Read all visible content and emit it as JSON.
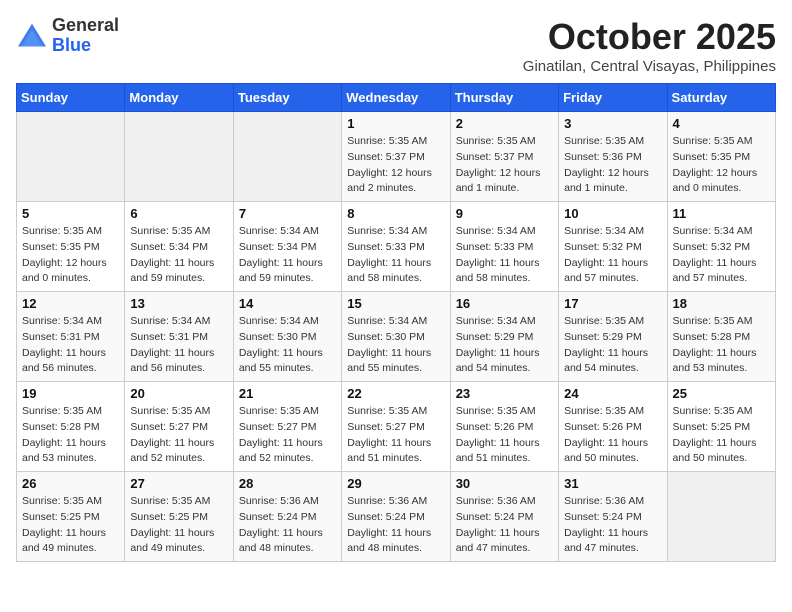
{
  "header": {
    "logo_general": "General",
    "logo_blue": "Blue",
    "month": "October 2025",
    "location": "Ginatilan, Central Visayas, Philippines"
  },
  "days_of_week": [
    "Sunday",
    "Monday",
    "Tuesday",
    "Wednesday",
    "Thursday",
    "Friday",
    "Saturday"
  ],
  "weeks": [
    [
      {
        "day": "",
        "info": ""
      },
      {
        "day": "",
        "info": ""
      },
      {
        "day": "",
        "info": ""
      },
      {
        "day": "1",
        "info": "Sunrise: 5:35 AM\nSunset: 5:37 PM\nDaylight: 12 hours\nand 2 minutes."
      },
      {
        "day": "2",
        "info": "Sunrise: 5:35 AM\nSunset: 5:37 PM\nDaylight: 12 hours\nand 1 minute."
      },
      {
        "day": "3",
        "info": "Sunrise: 5:35 AM\nSunset: 5:36 PM\nDaylight: 12 hours\nand 1 minute."
      },
      {
        "day": "4",
        "info": "Sunrise: 5:35 AM\nSunset: 5:35 PM\nDaylight: 12 hours\nand 0 minutes."
      }
    ],
    [
      {
        "day": "5",
        "info": "Sunrise: 5:35 AM\nSunset: 5:35 PM\nDaylight: 12 hours\nand 0 minutes."
      },
      {
        "day": "6",
        "info": "Sunrise: 5:35 AM\nSunset: 5:34 PM\nDaylight: 11 hours\nand 59 minutes."
      },
      {
        "day": "7",
        "info": "Sunrise: 5:34 AM\nSunset: 5:34 PM\nDaylight: 11 hours\nand 59 minutes."
      },
      {
        "day": "8",
        "info": "Sunrise: 5:34 AM\nSunset: 5:33 PM\nDaylight: 11 hours\nand 58 minutes."
      },
      {
        "day": "9",
        "info": "Sunrise: 5:34 AM\nSunset: 5:33 PM\nDaylight: 11 hours\nand 58 minutes."
      },
      {
        "day": "10",
        "info": "Sunrise: 5:34 AM\nSunset: 5:32 PM\nDaylight: 11 hours\nand 57 minutes."
      },
      {
        "day": "11",
        "info": "Sunrise: 5:34 AM\nSunset: 5:32 PM\nDaylight: 11 hours\nand 57 minutes."
      }
    ],
    [
      {
        "day": "12",
        "info": "Sunrise: 5:34 AM\nSunset: 5:31 PM\nDaylight: 11 hours\nand 56 minutes."
      },
      {
        "day": "13",
        "info": "Sunrise: 5:34 AM\nSunset: 5:31 PM\nDaylight: 11 hours\nand 56 minutes."
      },
      {
        "day": "14",
        "info": "Sunrise: 5:34 AM\nSunset: 5:30 PM\nDaylight: 11 hours\nand 55 minutes."
      },
      {
        "day": "15",
        "info": "Sunrise: 5:34 AM\nSunset: 5:30 PM\nDaylight: 11 hours\nand 55 minutes."
      },
      {
        "day": "16",
        "info": "Sunrise: 5:34 AM\nSunset: 5:29 PM\nDaylight: 11 hours\nand 54 minutes."
      },
      {
        "day": "17",
        "info": "Sunrise: 5:35 AM\nSunset: 5:29 PM\nDaylight: 11 hours\nand 54 minutes."
      },
      {
        "day": "18",
        "info": "Sunrise: 5:35 AM\nSunset: 5:28 PM\nDaylight: 11 hours\nand 53 minutes."
      }
    ],
    [
      {
        "day": "19",
        "info": "Sunrise: 5:35 AM\nSunset: 5:28 PM\nDaylight: 11 hours\nand 53 minutes."
      },
      {
        "day": "20",
        "info": "Sunrise: 5:35 AM\nSunset: 5:27 PM\nDaylight: 11 hours\nand 52 minutes."
      },
      {
        "day": "21",
        "info": "Sunrise: 5:35 AM\nSunset: 5:27 PM\nDaylight: 11 hours\nand 52 minutes."
      },
      {
        "day": "22",
        "info": "Sunrise: 5:35 AM\nSunset: 5:27 PM\nDaylight: 11 hours\nand 51 minutes."
      },
      {
        "day": "23",
        "info": "Sunrise: 5:35 AM\nSunset: 5:26 PM\nDaylight: 11 hours\nand 51 minutes."
      },
      {
        "day": "24",
        "info": "Sunrise: 5:35 AM\nSunset: 5:26 PM\nDaylight: 11 hours\nand 50 minutes."
      },
      {
        "day": "25",
        "info": "Sunrise: 5:35 AM\nSunset: 5:25 PM\nDaylight: 11 hours\nand 50 minutes."
      }
    ],
    [
      {
        "day": "26",
        "info": "Sunrise: 5:35 AM\nSunset: 5:25 PM\nDaylight: 11 hours\nand 49 minutes."
      },
      {
        "day": "27",
        "info": "Sunrise: 5:35 AM\nSunset: 5:25 PM\nDaylight: 11 hours\nand 49 minutes."
      },
      {
        "day": "28",
        "info": "Sunrise: 5:36 AM\nSunset: 5:24 PM\nDaylight: 11 hours\nand 48 minutes."
      },
      {
        "day": "29",
        "info": "Sunrise: 5:36 AM\nSunset: 5:24 PM\nDaylight: 11 hours\nand 48 minutes."
      },
      {
        "day": "30",
        "info": "Sunrise: 5:36 AM\nSunset: 5:24 PM\nDaylight: 11 hours\nand 47 minutes."
      },
      {
        "day": "31",
        "info": "Sunrise: 5:36 AM\nSunset: 5:24 PM\nDaylight: 11 hours\nand 47 minutes."
      },
      {
        "day": "",
        "info": ""
      }
    ]
  ]
}
